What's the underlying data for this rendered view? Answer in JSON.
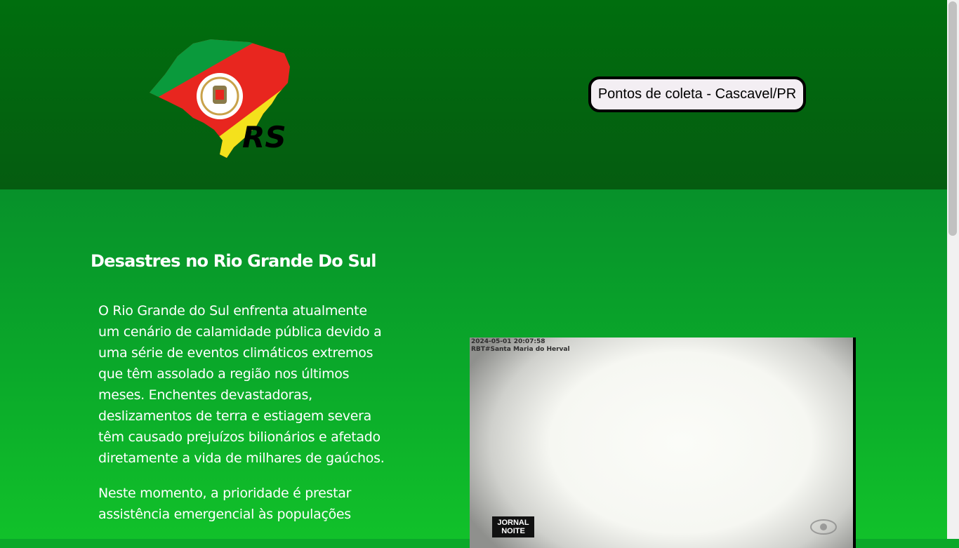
{
  "header": {
    "logo_text": "RS",
    "cta_label": "Pontos de coleta - Cascavel/PR"
  },
  "main": {
    "title": "Desastres no Rio Grande Do Sul",
    "paragraphs": [
      "O Rio Grande do Sul enfrenta atualmente um cenário de calamidade pública devido a uma série de eventos climáticos extremos que têm assolado a região nos últimos meses. Enchentes devastadoras, deslizamentos de terra e estiagem severa têm causado prejuízos bilionários e afetado diretamente a vida de milhares de gaúchos.",
      "Neste momento, a prioridade é prestar assistência emergencial às populações"
    ]
  },
  "video": {
    "timestamp": "2024-05-01  20:07:58",
    "camera_label": "RBT#Santa Maria do Herval",
    "channel_logo_line1": "JORNAL",
    "channel_logo_line2": "NOITE"
  },
  "colors": {
    "header_bg": "#055c10",
    "main_bg": "#0aa82a",
    "flag_green": "#0a9a3c",
    "flag_red": "#e8261f",
    "flag_yellow": "#f4e11c"
  }
}
